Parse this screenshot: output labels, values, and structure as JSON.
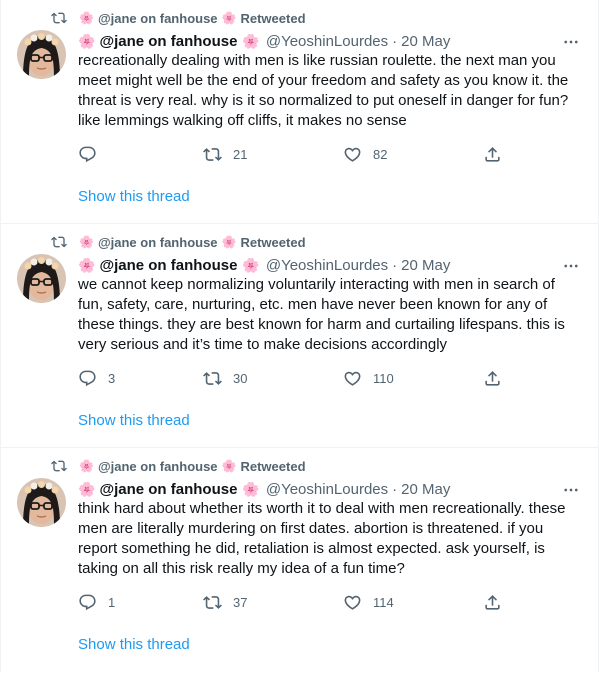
{
  "tweets": [
    {
      "retweeted_by": "@jane on fanhouse",
      "retweeted_label": "Retweeted",
      "author_name": "@jane on fanhouse",
      "author_handle": "@YeoshinLourdes",
      "separator": "·",
      "date": "20 May",
      "text": "recreationally dealing with men is like russian roulette. the next man you meet might well be the end of your freedom and safety as you know it. the threat is very real. why is it so normalized to put oneself in danger for fun? like lemmings walking off cliffs, it makes no sense",
      "replies": "",
      "retweets": "21",
      "likes": "82",
      "show_thread": "Show this thread"
    },
    {
      "retweeted_by": "@jane on fanhouse",
      "retweeted_label": "Retweeted",
      "author_name": "@jane on fanhouse",
      "author_handle": "@YeoshinLourdes",
      "separator": "·",
      "date": "20 May",
      "text": "we cannot keep normalizing voluntarily interacting with men in search of fun, safety, care, nurturing, etc. men have never been known for any of these things. they are best known for harm and curtailing lifespans. this is very serious and it’s time to make decisions accordingly",
      "replies": "3",
      "retweets": "30",
      "likes": "110",
      "show_thread": "Show this thread"
    },
    {
      "retweeted_by": "@jane on fanhouse",
      "retweeted_label": "Retweeted",
      "author_name": "@jane on fanhouse",
      "author_handle": "@YeoshinLourdes",
      "separator": "·",
      "date": "20 May",
      "text": "think hard about whether its worth it to deal with men recreationally. these men are literally murdering on first dates. abortion is threatened. if you report something he did, retaliation is almost expected. ask yourself, is taking on all this risk really my idea of a fun time?",
      "replies": "1",
      "retweets": "37",
      "likes": "114",
      "show_thread": "Show this thread"
    }
  ],
  "icons": {
    "retweet": "retweet-icon",
    "more": "more-icon",
    "reply": "reply-icon",
    "like": "heart-icon",
    "share": "share-icon",
    "flower": "cherry-blossom-icon"
  },
  "colors": {
    "link": "#1d9bf0",
    "secondary": "#536471",
    "primary_text": "#0f1419",
    "divider": "#eff3f4"
  }
}
